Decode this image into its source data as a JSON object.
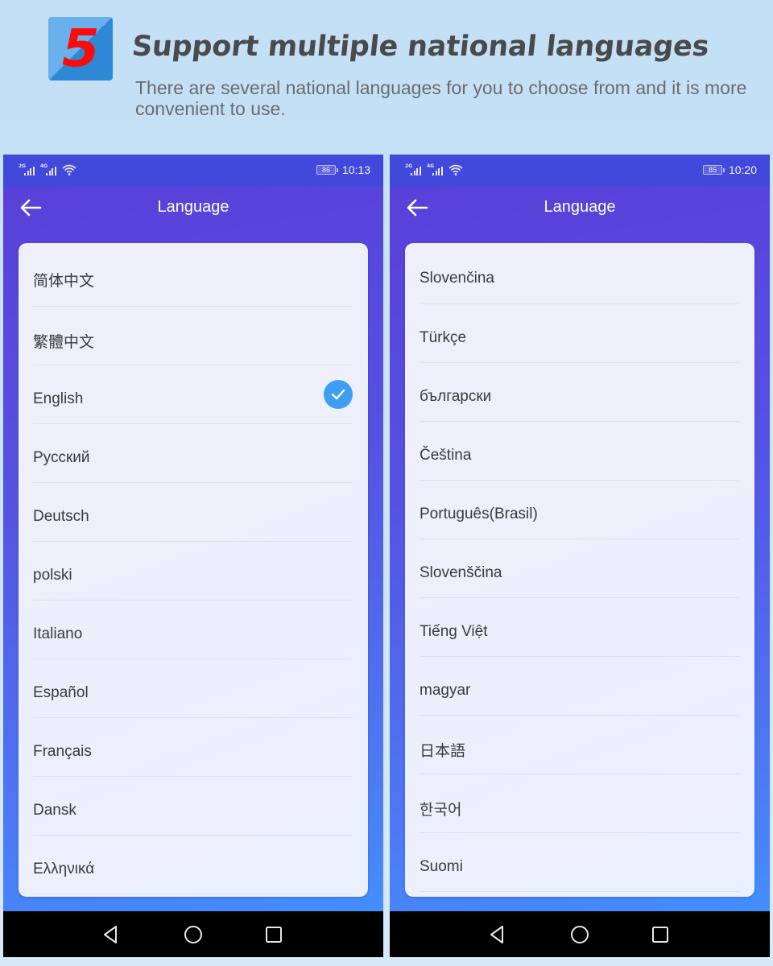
{
  "banner": {
    "number": "5",
    "title": "Support multiple national languages",
    "subtitle": "There are several national languages for you to choose from and it is more convenient to use."
  },
  "phones": [
    {
      "status": {
        "network_1": "2G",
        "network_2": "4G",
        "battery": "86",
        "time": "10:13"
      },
      "appbar": {
        "title": "Language",
        "back_icon": "arrow-left-icon"
      },
      "languages": [
        {
          "label": "简体中文",
          "selected": false
        },
        {
          "label": "繁體中文",
          "selected": false
        },
        {
          "label": "English",
          "selected": true
        },
        {
          "label": "Русский",
          "selected": false
        },
        {
          "label": "Deutsch",
          "selected": false
        },
        {
          "label": "polski",
          "selected": false
        },
        {
          "label": "Italiano",
          "selected": false
        },
        {
          "label": "Español",
          "selected": false
        },
        {
          "label": "Français",
          "selected": false
        },
        {
          "label": "Dansk",
          "selected": false
        },
        {
          "label": "Ελληνικά",
          "selected": false
        }
      ],
      "navbar": [
        "back-triangle-icon",
        "home-circle-icon",
        "recent-square-icon"
      ]
    },
    {
      "status": {
        "network_1": "2G",
        "network_2": "4G",
        "battery": "85",
        "time": "10:20"
      },
      "appbar": {
        "title": "Language",
        "back_icon": "arrow-left-icon"
      },
      "languages": [
        {
          "label": "Slovenčina",
          "selected": false
        },
        {
          "label": "Türkçe",
          "selected": false
        },
        {
          "label": "български",
          "selected": false
        },
        {
          "label": "Čeština",
          "selected": false
        },
        {
          "label": "Português(Brasil)",
          "selected": false
        },
        {
          "label": "Slovenščina",
          "selected": false
        },
        {
          "label": "Tiếng Việt",
          "selected": false
        },
        {
          "label": "magyar",
          "selected": false
        },
        {
          "label": "日本語",
          "selected": false
        },
        {
          "label": "한국어",
          "selected": false
        },
        {
          "label": "Suomi",
          "selected": false
        }
      ],
      "navbar": [
        "back-triangle-icon",
        "home-circle-icon",
        "recent-square-icon"
      ]
    }
  ],
  "colors": {
    "accent_check": "#3d9ef3",
    "status_bar": "#4248dc",
    "badge_number": "#ff0a0a"
  }
}
